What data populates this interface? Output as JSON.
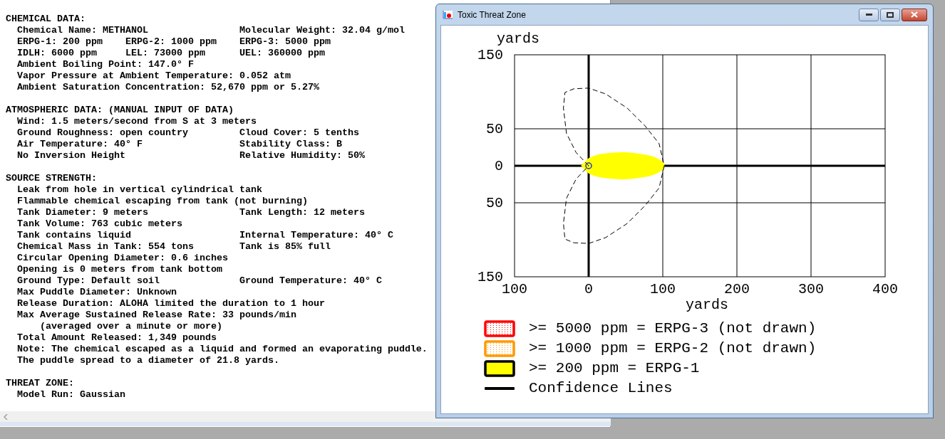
{
  "report": {
    "sections": [
      {
        "title": "CHEMICAL DATA:",
        "lines": [
          {
            "kind": "item",
            "text": "Chemical Name: METHANOL",
            "right": "Molecular Weight: 32.04 g/mol"
          },
          {
            "kind": "item",
            "text": "ERPG-1: 200 ppm    ERPG-2: 1000 ppm",
            "right": "ERPG-3: 5000 ppm"
          },
          {
            "kind": "item",
            "text": "IDLH: 6000 ppm     LEL: 73000 ppm",
            "right": "UEL: 360000 ppm"
          },
          {
            "kind": "item",
            "text": "Ambient Boiling Point: 147.0° F"
          },
          {
            "kind": "item",
            "text": "Vapor Pressure at Ambient Temperature: 0.052 atm"
          },
          {
            "kind": "item",
            "text": "Ambient Saturation Concentration: 52,670 ppm or 5.27%"
          }
        ]
      },
      {
        "title": "ATMOSPHERIC DATA: (MANUAL INPUT OF DATA)",
        "lines": [
          {
            "kind": "item",
            "text": "Wind: 1.5 meters/second from S at 3 meters"
          },
          {
            "kind": "item",
            "text": "Ground Roughness: open country",
            "right": "Cloud Cover: 5 tenths"
          },
          {
            "kind": "item",
            "text": "Air Temperature: 40° F",
            "right": "Stability Class: B"
          },
          {
            "kind": "item",
            "text": "No Inversion Height",
            "right": "Relative Humidity: 50%"
          }
        ]
      },
      {
        "title": "SOURCE STRENGTH:",
        "lines": [
          {
            "kind": "item",
            "text": "Leak from hole in vertical cylindrical tank"
          },
          {
            "kind": "item",
            "text": "Flammable chemical escaping from tank (not burning)"
          },
          {
            "kind": "item",
            "text": "Tank Diameter: 9 meters",
            "right": "Tank Length: 12 meters"
          },
          {
            "kind": "item",
            "text": "Tank Volume: 763 cubic meters"
          },
          {
            "kind": "item",
            "text": "Tank contains liquid",
            "right": "Internal Temperature: 40° C"
          },
          {
            "kind": "item",
            "text": "Chemical Mass in Tank: 554 tons",
            "right": "Tank is 85% full"
          },
          {
            "kind": "item",
            "text": "Circular Opening Diameter: 0.6 inches"
          },
          {
            "kind": "item",
            "text": "Opening is 0 meters from tank bottom"
          },
          {
            "kind": "item",
            "text": "Ground Type: Default soil",
            "right": "Ground Temperature: 40° C"
          },
          {
            "kind": "item",
            "text": "Max Puddle Diameter: Unknown"
          },
          {
            "kind": "item",
            "text": "Release Duration: ALOHA limited the duration to 1 hour"
          },
          {
            "kind": "item",
            "text": "Max Average Sustained Release Rate: 33 pounds/min"
          },
          {
            "kind": "continuation",
            "text": "(averaged over a minute or more)"
          },
          {
            "kind": "item",
            "text": "Total Amount Released: 1,349 pounds"
          },
          {
            "kind": "item",
            "text": "Note: The chemical escaped as a liquid and formed an evaporating puddle."
          },
          {
            "kind": "item",
            "text": "The puddle spread to a diameter of 21.8 yards."
          }
        ]
      },
      {
        "title": "THREAT ZONE:",
        "lines": [
          {
            "kind": "item",
            "text": "Model Run: Gaussian"
          }
        ]
      }
    ]
  },
  "window": {
    "title": "Toxic Threat Zone"
  },
  "chart_data": {
    "type": "area",
    "xlabel": "yards",
    "ylabel": "yards",
    "xlim": [
      -100,
      400
    ],
    "ylim": [
      -150,
      150
    ],
    "xticks": [
      {
        "value": -100,
        "label": "100"
      },
      0,
      100,
      200,
      300,
      400
    ],
    "yticks": [
      150,
      50,
      0,
      {
        "value": -50,
        "label": "50"
      },
      {
        "value": -150,
        "label": "150"
      }
    ],
    "grid": true
  },
  "legend": [
    {
      "kind": "dotted",
      "color": "#ff0000",
      "label": ">= 5000 ppm = ERPG-3 (not drawn)"
    },
    {
      "kind": "dotted",
      "color": "#ff9900",
      "label": ">= 1000 ppm = ERPG-2 (not drawn)"
    },
    {
      "kind": "filled",
      "color": "#ffff00",
      "label": ">= 200 ppm = ERPG-1"
    },
    {
      "kind": "line",
      "color": "#000000",
      "label": "Confidence Lines"
    }
  ]
}
